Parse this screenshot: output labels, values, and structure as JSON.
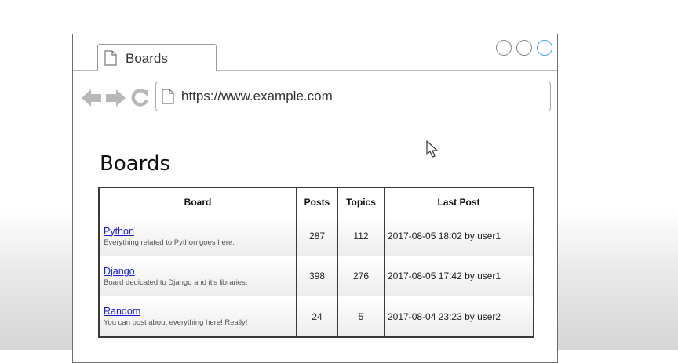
{
  "window": {
    "tab_title": "Boards",
    "url": "https://www.example.com"
  },
  "page": {
    "title": "Boards"
  },
  "table": {
    "headers": [
      "Board",
      "Posts",
      "Topics",
      "Last Post"
    ],
    "rows": [
      {
        "name": "Python",
        "description": "Everything related to Python goes here.",
        "posts": "287",
        "topics": "112",
        "last_post": "2017-08-05 18:02 by user1"
      },
      {
        "name": "Django",
        "description": "Board dedicated to Django and it's libraries.",
        "posts": "398",
        "topics": "276",
        "last_post": "2017-08-05 17:42 by user1"
      },
      {
        "name": "Random",
        "description": "You can post about everything here! Really!",
        "posts": "24",
        "topics": "5",
        "last_post": "2017-08-04 23:23 by user2"
      }
    ]
  },
  "icons": {
    "tab": "page-icon",
    "back": "back-arrow-icon",
    "forward": "forward-arrow-icon",
    "reload": "reload-icon",
    "url": "page-icon",
    "cursor": "mouse-pointer-icon"
  },
  "colors": {
    "link": "#1a1ad6",
    "window_control_active": "#4aa6e0",
    "nav_icon": "#b8b8b8"
  }
}
